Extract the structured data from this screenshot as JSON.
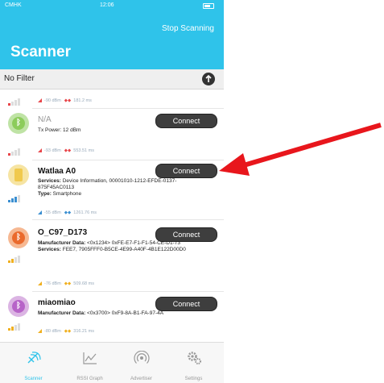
{
  "status_bar": {
    "carrier": "CMHK",
    "time": "12:06"
  },
  "nav": {
    "stop_label": "Stop Scanning",
    "title": "Scanner"
  },
  "filter": {
    "label": "No Filter"
  },
  "first_partial": {
    "rssi": "-90 dBm",
    "interval": "181.2 ms"
  },
  "devices": [
    {
      "name": "N/A",
      "line1": "Tx Power: 12 dBm",
      "rssi": "-93 dBm",
      "interval": "553.51 ms",
      "connect": "Connect"
    },
    {
      "name": "Watlaa A0",
      "services_label": "Services:",
      "services": "Device Information, 00001010-1212-EFDE-0137-875F45AC0113",
      "type_label": "Type:",
      "type": "Smartphone",
      "rssi": "-55 dBm",
      "interval": "1261.76 ms",
      "connect": "Connect"
    },
    {
      "name": "O_C97_D173",
      "mfr_label": "Manufacturer Data:",
      "mfr": "<0x1234> 0xFE-E7-F1-F1-54-CE-D1-73",
      "services_label": "Services:",
      "services": "FEE7, 7905FFF0-B5CE-4E99-A40F-4B1E122D00D0",
      "rssi": "-76 dBm",
      "interval": "509.68 ms",
      "connect": "Connect"
    },
    {
      "name": "miaomiao",
      "mfr_label": "Manufacturer Data:",
      "mfr": "<0x3700> 0xF9-8A-B1-FA-97-4A",
      "rssi": "-80 dBm",
      "interval": "316.21 ms",
      "connect": "Connect"
    }
  ],
  "tabs": [
    {
      "label": "Scanner",
      "icon": "scanner-icon"
    },
    {
      "label": "RSSI Graph",
      "icon": "graph-icon"
    },
    {
      "label": "Advertiser",
      "icon": "advertiser-icon"
    },
    {
      "label": "Settings",
      "icon": "gears-icon"
    }
  ],
  "colors": {
    "accent": "#2fc3ea",
    "arrow": "#e8161c"
  }
}
